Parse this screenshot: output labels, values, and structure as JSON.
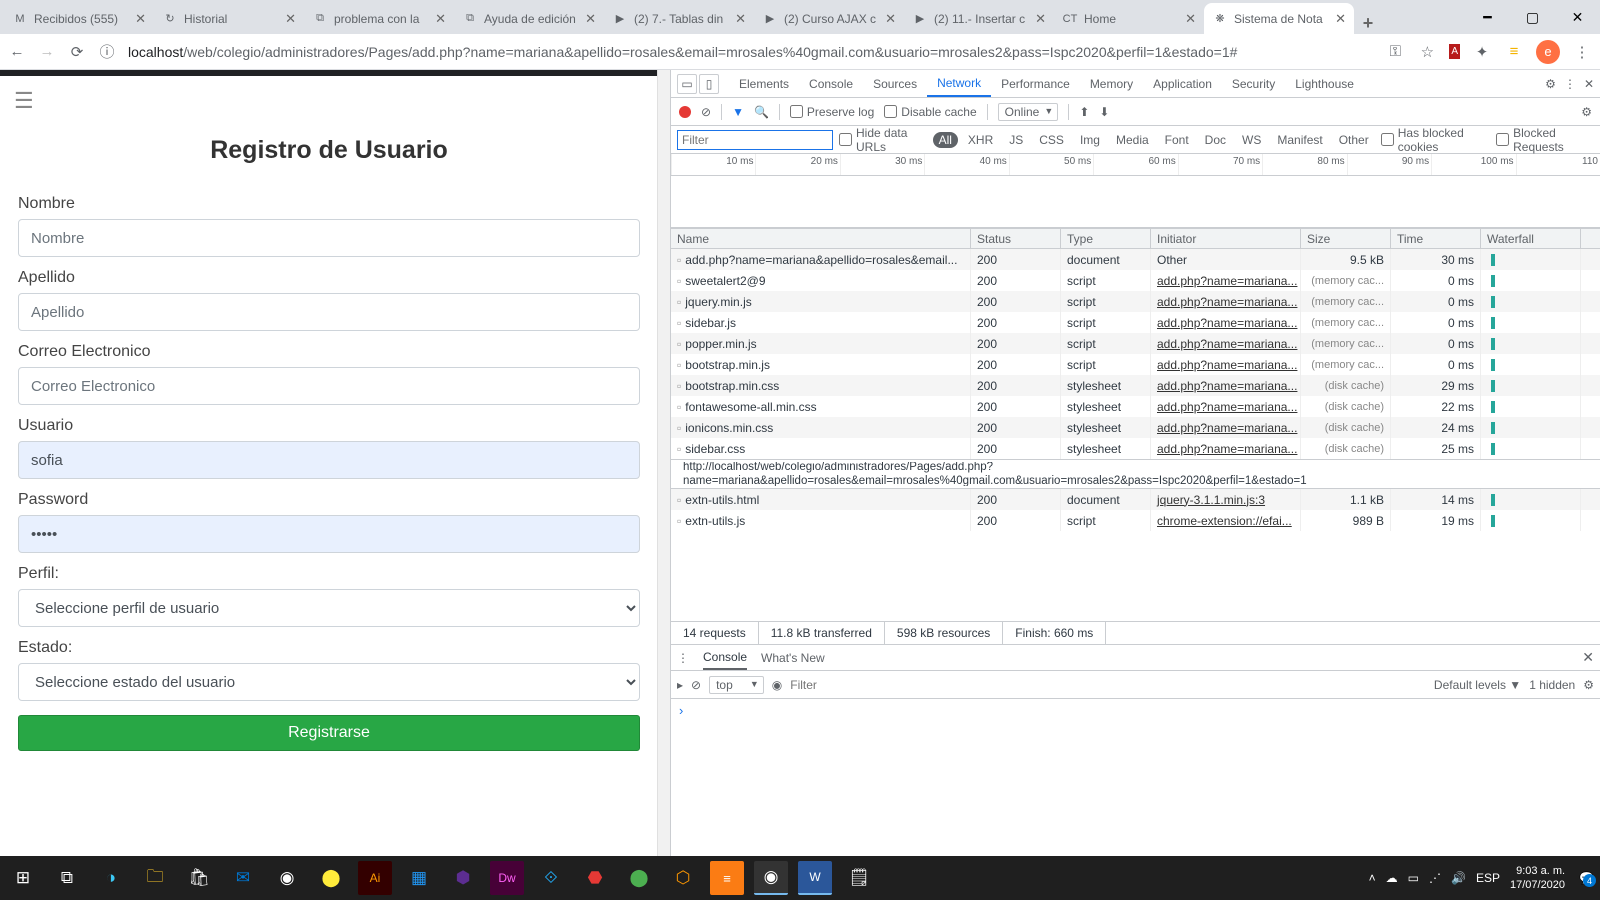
{
  "browser": {
    "tabs": [
      {
        "favicon": "M",
        "label": "Recibidos (555)"
      },
      {
        "favicon": "↻",
        "label": "Historial"
      },
      {
        "favicon": "⧉",
        "label": "problema con la"
      },
      {
        "favicon": "⧉",
        "label": "Ayuda de edición"
      },
      {
        "favicon": "▶",
        "label": "(2) 7.- Tablas din"
      },
      {
        "favicon": "▶",
        "label": "(2) Curso AJAX c"
      },
      {
        "favicon": "▶",
        "label": "(2) 11.- Insertar c"
      },
      {
        "favicon": "CT",
        "label": "Home"
      },
      {
        "favicon": "❋",
        "label": "Sistema de Nota",
        "active": true
      }
    ],
    "url_host": "localhost",
    "url_path": "/web/colegio/administradores/Pages/add.php?name=mariana&apellido=rosales&email=mrosales%40gmail.com&usuario=mrosales2&pass=Ispc2020&perfil=1&estado=1#",
    "avatar_letter": "e"
  },
  "form": {
    "title": "Registro de Usuario",
    "nombre_label": "Nombre",
    "nombre_ph": "Nombre",
    "apellido_label": "Apellido",
    "apellido_ph": "Apellido",
    "correo_label": "Correo Electronico",
    "correo_ph": "Correo Electronico",
    "usuario_label": "Usuario",
    "usuario_val": "sofia",
    "password_label": "Password",
    "password_val": "•••••",
    "perfil_label": "Perfil:",
    "perfil_sel": "Seleccione perfil de usuario",
    "estado_label": "Estado:",
    "estado_sel": "Seleccione estado del usuario",
    "submit": "Registrarse"
  },
  "devtools": {
    "tabs": [
      "Elements",
      "Console",
      "Sources",
      "Network",
      "Performance",
      "Memory",
      "Application",
      "Security",
      "Lighthouse"
    ],
    "active_tab": "Network",
    "toolbar": {
      "preserve": "Preserve log",
      "disable": "Disable cache",
      "throttle": "Online"
    },
    "filters": {
      "ph": "Filter",
      "hide": "Hide data URLs",
      "types": [
        "All",
        "XHR",
        "JS",
        "CSS",
        "Img",
        "Media",
        "Font",
        "Doc",
        "WS",
        "Manifest",
        "Other"
      ],
      "blocked": "Has blocked cookies",
      "blockedReq": "Blocked Requests"
    },
    "timeline": [
      "10 ms",
      "20 ms",
      "30 ms",
      "40 ms",
      "50 ms",
      "60 ms",
      "70 ms",
      "80 ms",
      "90 ms",
      "100 ms",
      "110"
    ],
    "columns": [
      "Name",
      "Status",
      "Type",
      "Initiator",
      "Size",
      "Time",
      "Waterfall"
    ],
    "rows": [
      {
        "name": "add.php?name=mariana&apellido=rosales&email...",
        "status": "200",
        "type": "document",
        "initiator": "Other",
        "initLink": false,
        "size": "9.5 kB",
        "time": "30 ms"
      },
      {
        "name": "sweetalert2@9",
        "status": "200",
        "type": "script",
        "initiator": "add.php?name=mariana...",
        "initLink": true,
        "size": "(memory cac...",
        "time": "0 ms"
      },
      {
        "name": "jquery.min.js",
        "status": "200",
        "type": "script",
        "initiator": "add.php?name=mariana...",
        "initLink": true,
        "size": "(memory cac...",
        "time": "0 ms"
      },
      {
        "name": "sidebar.js",
        "status": "200",
        "type": "script",
        "initiator": "add.php?name=mariana...",
        "initLink": true,
        "size": "(memory cac...",
        "time": "0 ms"
      },
      {
        "name": "popper.min.js",
        "status": "200",
        "type": "script",
        "initiator": "add.php?name=mariana...",
        "initLink": true,
        "size": "(memory cac...",
        "time": "0 ms"
      },
      {
        "name": "bootstrap.min.js",
        "status": "200",
        "type": "script",
        "initiator": "add.php?name=mariana...",
        "initLink": true,
        "size": "(memory cac...",
        "time": "0 ms"
      },
      {
        "name": "bootstrap.min.css",
        "status": "200",
        "type": "stylesheet",
        "initiator": "add.php?name=mariana...",
        "initLink": true,
        "size": "(disk cache)",
        "time": "29 ms"
      },
      {
        "name": "fontawesome-all.min.css",
        "status": "200",
        "type": "stylesheet",
        "initiator": "add.php?name=mariana...",
        "initLink": true,
        "size": "(disk cache)",
        "time": "22 ms"
      },
      {
        "name": "ionicons.min.css",
        "status": "200",
        "type": "stylesheet",
        "initiator": "add.php?name=mariana...",
        "initLink": true,
        "size": "(disk cache)",
        "time": "24 ms"
      },
      {
        "name": "sidebar.css",
        "status": "200",
        "type": "stylesheet",
        "initiator": "add.php?name=mariana...",
        "initLink": true,
        "size": "(disk cache)",
        "time": "25 ms"
      }
    ],
    "tooltip": "http://localhost/web/colegio/administradores/Pages/add.php?name=mariana&apellido=rosales&email=mrosales%40gmail.com&usuario=mrosales2&pass=Ispc2020&perfil=1&estado=1",
    "rows2": [
      {
        "name": "extn-utils.html",
        "status": "200",
        "type": "document",
        "initiator": "jquery-3.1.1.min.js:3",
        "initLink": true,
        "size": "1.1 kB",
        "time": "14 ms"
      },
      {
        "name": "extn-utils.js",
        "status": "200",
        "type": "script",
        "initiator": "chrome-extension://efai...",
        "initLink": true,
        "size": "989 B",
        "time": "19 ms"
      }
    ],
    "status": [
      "14 requests",
      "11.8 kB transferred",
      "598 kB resources",
      "Finish: 660 ms"
    ],
    "drawer": {
      "tabs": [
        "Console",
        "What's New"
      ],
      "top": "top",
      "filter_ph": "Filter",
      "levels": "Default levels",
      "hidden": "1 hidden"
    }
  },
  "taskbar": {
    "tray_lang": "ESP",
    "clock_time": "9:03 a. m.",
    "clock_date": "17/07/2020",
    "notif_count": "4"
  }
}
